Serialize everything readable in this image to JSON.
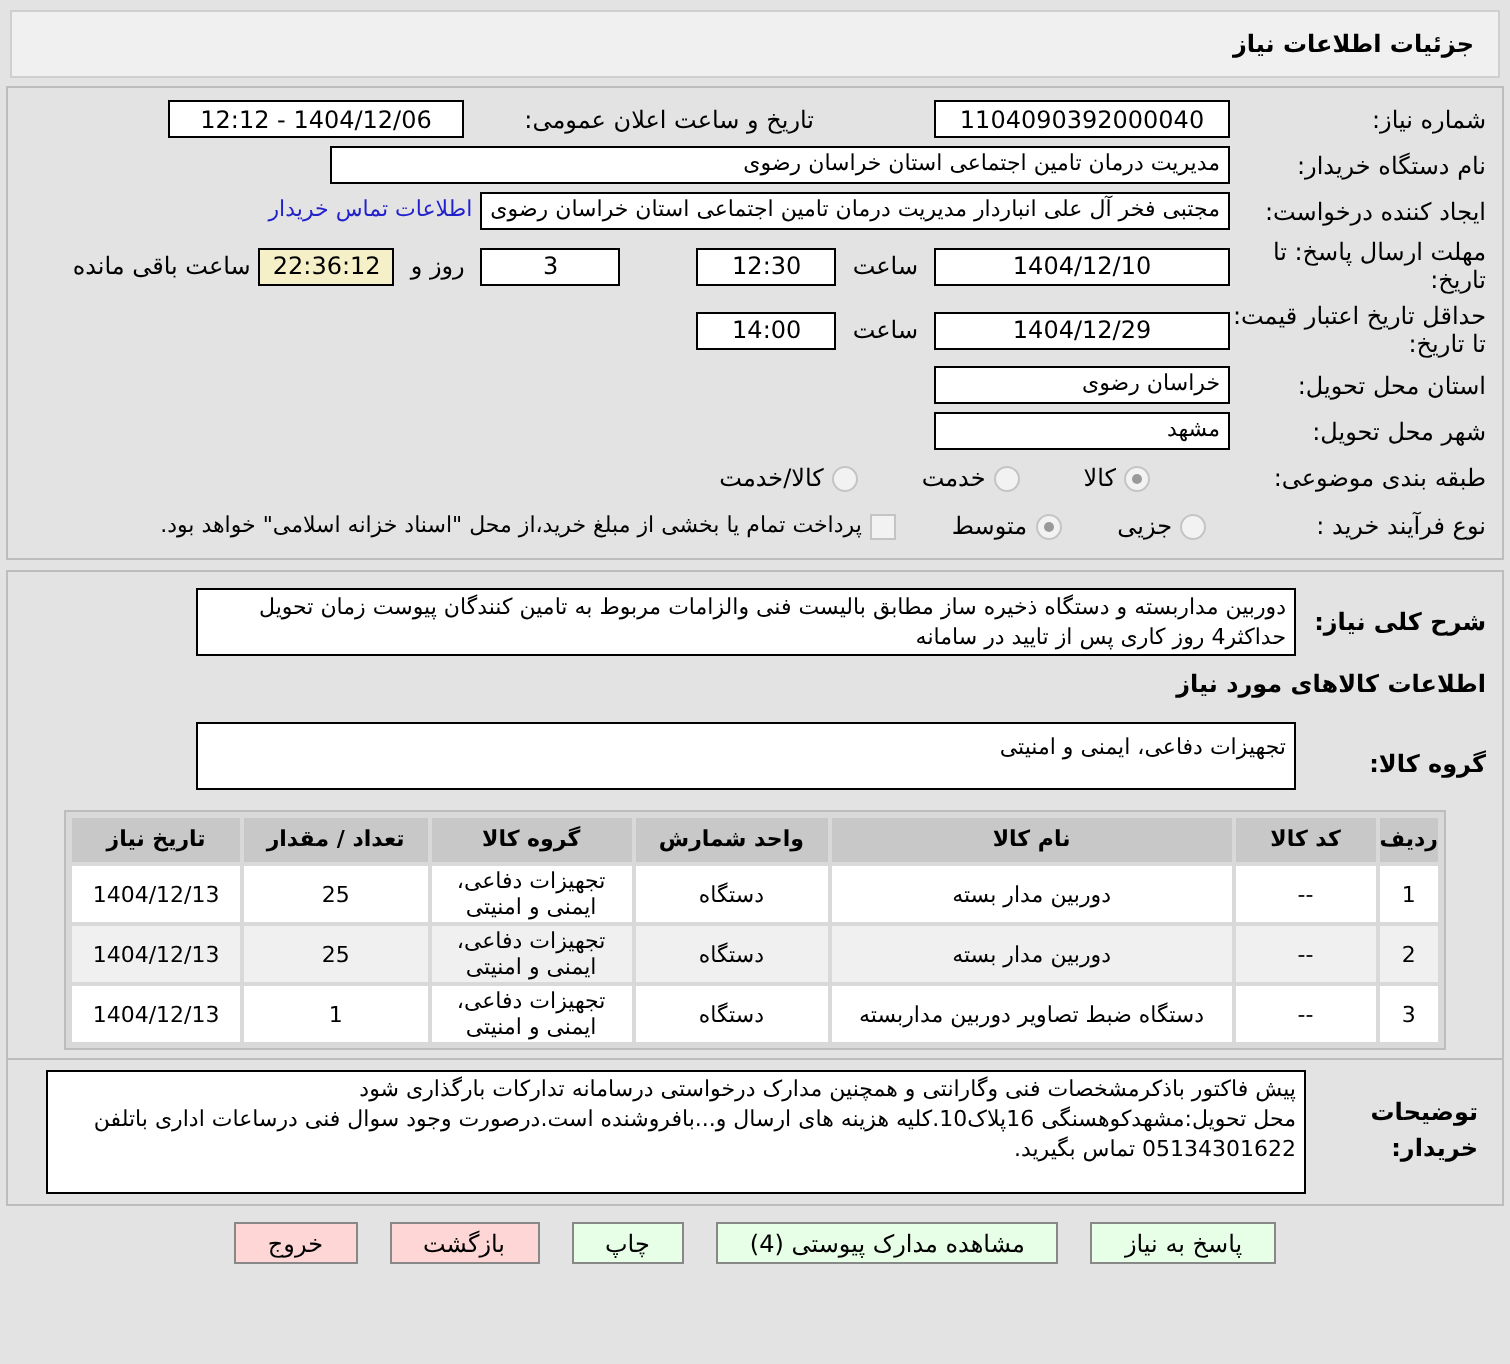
{
  "title": "جزئیات اطلاعات نیاز",
  "need_number": {
    "label": "شماره نیاز:",
    "value": "1104090392000040"
  },
  "announce": {
    "label": "تاریخ و ساعت اعلان عمومی:",
    "value": "1404/12/06 - 12:12"
  },
  "buyer": {
    "label": "نام دستگاه خریدار:",
    "value": "مدیریت درمان تامین اجتماعی استان خراسان رضوی"
  },
  "creator": {
    "label": "ایجاد کننده درخواست:",
    "value": "مجتبی فخر آل علی انباردار مدیریت درمان تامین اجتماعی استان خراسان رضوی",
    "link": "اطلاعات تماس خریدار"
  },
  "deadline": {
    "label": "مهلت ارسال پاسخ: تا تاریخ:",
    "date": "1404/12/10",
    "time_label": "ساعت",
    "time": "12:30",
    "days": "3",
    "days_label": "روز و",
    "remaining": "22:36:12",
    "remaining_label": "ساعت باقی مانده"
  },
  "validity": {
    "label": "حداقل تاریخ اعتبار قیمت: تا تاریخ:",
    "date": "1404/12/29",
    "time_label": "ساعت",
    "time": "14:00"
  },
  "province": {
    "label": "استان محل تحویل:",
    "value": "خراسان رضوی"
  },
  "city": {
    "label": "شهر محل تحویل:",
    "value": "مشهد"
  },
  "category": {
    "label": "طبقه بندی موضوعی:",
    "options": [
      {
        "label": "کالا",
        "selected": true
      },
      {
        "label": "خدمت",
        "selected": false
      },
      {
        "label": "کالا/خدمت",
        "selected": false
      }
    ]
  },
  "process": {
    "label": "نوع فرآیند خرید :",
    "options": [
      {
        "label": "جزیی",
        "selected": false
      },
      {
        "label": "متوسط",
        "selected": true
      }
    ],
    "checkbox": {
      "label": "پرداخت تمام یا بخشی از مبلغ خرید،از محل \"اسناد خزانه اسلامی\" خواهد بود.",
      "checked": false
    }
  },
  "description": {
    "label": "شرح کلی نیاز:",
    "value": "دوربین مداربسته و دستگاه ذخیره ساز مطابق بالیست فنی والزامات مربوط به تامین کنندگان پیوست زمان تحویل حداکثر4 روز کاری پس از تایید در سامانه"
  },
  "goods_heading": "اطلاعات کالاهای مورد نیاز",
  "goods_group": {
    "label": "گروه کالا:",
    "value": "تجهیزات دفاعی، ایمنی و امنیتی"
  },
  "table": {
    "columns": [
      "ردیف",
      "کد کالا",
      "نام کالا",
      "واحد شمارش",
      "گروه کالا",
      "تعداد / مقدار",
      "تاریخ نیاز"
    ],
    "rows": [
      [
        "1",
        "--",
        "دوربین مدار بسته",
        "دستگاه",
        "تجهیزات دفاعی، ایمنی و امنیتی",
        "25",
        "1404/12/13"
      ],
      [
        "2",
        "--",
        "دوربین مدار بسته",
        "دستگاه",
        "تجهیزات دفاعی، ایمنی و امنیتی",
        "25",
        "1404/12/13"
      ],
      [
        "3",
        "--",
        "دستگاه ضبط تصاویر دوربین مداربسته",
        "دستگاه",
        "تجهیزات دفاعی، ایمنی و امنیتی",
        "1",
        "1404/12/13"
      ]
    ]
  },
  "notes": {
    "label": "توضیحات خریدار:",
    "value": "پیش فاکتور باذکرمشخصات فنی وگارانتی و همچنین مدارک درخواستی درسامانه تدارکات بارگذاری شود\nمحل تحویل:مشهدکوهسنگی 16پلاک10.کلیه هزینه های ارسال و...بافروشنده است.درصورت وجود سوال فنی درساعات اداری باتلفن 05134301622 تماس بگیرید."
  },
  "buttons": [
    {
      "label": "پاسخ به نیاز",
      "kind": "primary"
    },
    {
      "label": "مشاهده مدارک پیوستی (4)",
      "kind": "primary"
    },
    {
      "label": "چاپ",
      "kind": "primary"
    },
    {
      "label": "بازگشت",
      "kind": "danger"
    },
    {
      "label": "خروج",
      "kind": "danger"
    }
  ]
}
